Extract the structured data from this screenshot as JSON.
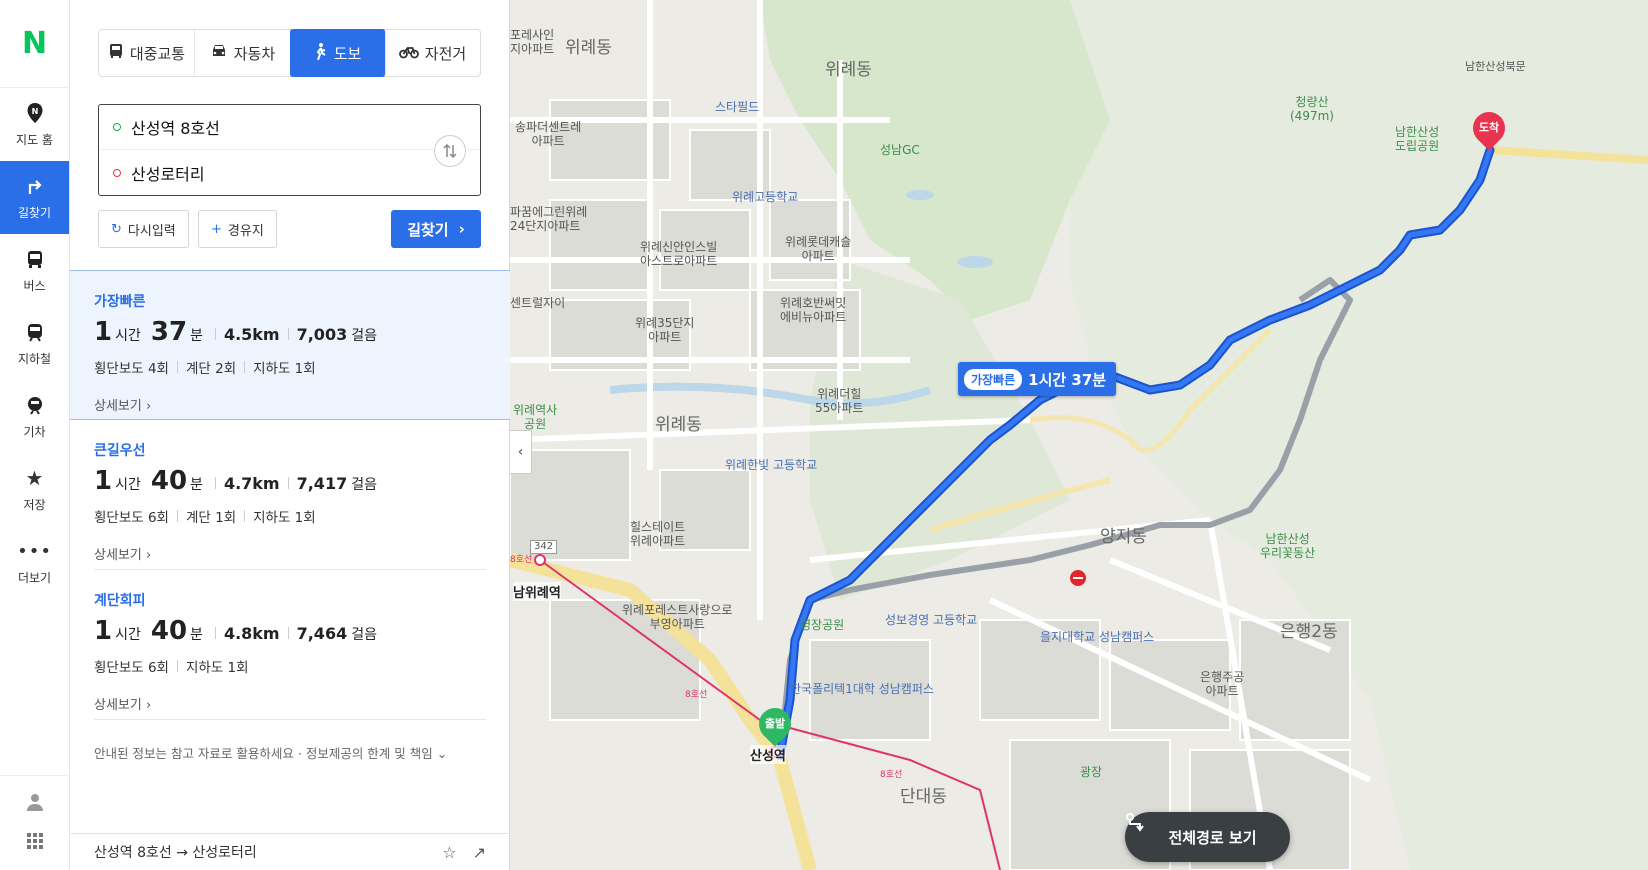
{
  "brand": {
    "logo": "N",
    "color": "#03c75a"
  },
  "rail": {
    "items": [
      {
        "label": "지도 홈",
        "icon": "map-pin-icon"
      },
      {
        "label": "길찾기",
        "icon": "direction-arrow-icon"
      },
      {
        "label": "버스",
        "icon": "bus-icon"
      },
      {
        "label": "지하철",
        "icon": "subway-icon"
      },
      {
        "label": "기차",
        "icon": "train-icon"
      },
      {
        "label": "저장",
        "icon": "star-icon"
      },
      {
        "label": "더보기",
        "icon": "more-icon"
      }
    ]
  },
  "modes": [
    {
      "label": "대중교통",
      "icon": "bus-icon"
    },
    {
      "label": "자동차",
      "icon": "car-icon"
    },
    {
      "label": "도보",
      "icon": "walk-icon",
      "active": true
    },
    {
      "label": "자전거",
      "icon": "bicycle-icon"
    }
  ],
  "search": {
    "origin": "산성역 8호선",
    "destination": "산성로터리"
  },
  "buttons": {
    "reset": "다시입력",
    "waypoint": "경유지",
    "go": "길찾기"
  },
  "routes": [
    {
      "name": "가장빠른",
      "hours": "1",
      "hour_unit": "시간",
      "minutes": "37",
      "min_unit": "분",
      "distance": "4.5km",
      "steps": "7,003",
      "steps_unit": "걸음",
      "meta": [
        "횡단보도 4회",
        "계단 2회",
        "지하도 1회"
      ],
      "more": "상세보기"
    },
    {
      "name": "큰길우선",
      "hours": "1",
      "hour_unit": "시간",
      "minutes": "40",
      "min_unit": "분",
      "distance": "4.7km",
      "steps": "7,417",
      "steps_unit": "걸음",
      "meta": [
        "횡단보도 6회",
        "계단 1회",
        "지하도 1회"
      ],
      "more": "상세보기"
    },
    {
      "name": "계단회피",
      "hours": "1",
      "hour_unit": "시간",
      "minutes": "40",
      "min_unit": "분",
      "distance": "4.8km",
      "steps": "7,464",
      "steps_unit": "걸음",
      "meta": [
        "횡단보도 6회",
        "지하도 1회"
      ],
      "more": "상세보기"
    }
  ],
  "notice": "안내된 정보는 참고 자료로 활용하세요 · 정보제공의 한계 및 책임 ⌄",
  "footer": {
    "text": "산성역 8호선 → 산성로터리"
  },
  "map": {
    "route_tag": {
      "pill": "가장빠른",
      "time": "1시간 37분"
    },
    "start_label": "출발",
    "end_label": "도착",
    "full_route_button": "전체경로 보기",
    "route_color": "#2a6ee8",
    "labels": {
      "l1": "포레사인\n지아파트",
      "l2": "위례동",
      "l3": "위례동",
      "l4": "스타필드",
      "l5": "송파더센트레\n아파트",
      "l6": "성남GC",
      "l7": "청량산\n(497m)",
      "l8": "남한산성\n도립공원",
      "l9": "남한산성북문",
      "l10": "위례고등학교",
      "l11": "파꿈에그린위례\n24단지아파트",
      "l12": "위례신안인스빌\n아스트로아파트",
      "l13": "위례롯데캐슬\n아파트",
      "l14": "센트럴자이",
      "l15": "위례35단지\n아파트",
      "l16": "위례호반써밋\n에비뉴아파트",
      "l17": "위례더힐\n55아파트",
      "l18": "위례역사\n공원",
      "l19": "위례동",
      "l20": "위례한빛 고등학교",
      "l21": "힐스테이트\n위례아파트",
      "l22": "양지동",
      "l23": "남한산성\n우리꽃동산",
      "l24": "남위례역",
      "l25": "위례포레스트사랑으로\n부영아파트",
      "l26": "영장공원",
      "l27": "성보경영 고등학교",
      "l28": "을지대학교 성남캠퍼스",
      "l29": "은행2동",
      "l30": "은행주공\n아파트",
      "l31": "한국폴리텍1대학 성남캠퍼스",
      "l32": "산성역",
      "l33": "광장",
      "l34": "단대동",
      "l35": "342",
      "l36": "8호선",
      "l37": "8호선",
      "l38": "8호선"
    }
  }
}
